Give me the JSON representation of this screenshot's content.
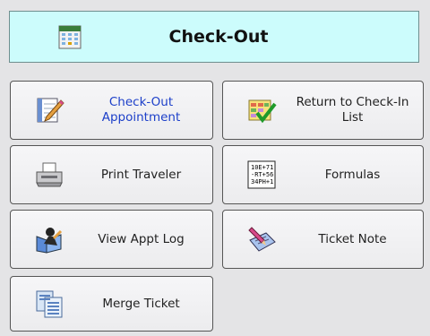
{
  "header": {
    "title": "Check-Out",
    "icon": "calendar-icon"
  },
  "buttons": {
    "checkout_appointment": {
      "label": "Check-Out\nAppointment",
      "icon": "appointment-edit-icon",
      "color": "#1c3fc9"
    },
    "return_checkin": {
      "label": "Return to Check-In\nList",
      "icon": "checklist-icon"
    },
    "print_traveler": {
      "label": "Print Traveler",
      "icon": "printer-icon"
    },
    "formulas": {
      "label": "Formulas",
      "icon": "formula-card-icon",
      "icon_text": [
        "10E+71",
        "-RT+56",
        "34PH+1"
      ]
    },
    "view_appt_log": {
      "label": "View Appt Log",
      "icon": "appointment-log-icon"
    },
    "ticket_note": {
      "label": "Ticket Note",
      "icon": "note-pencil-icon"
    },
    "merge_ticket": {
      "label": "Merge Ticket",
      "icon": "merge-documents-icon"
    }
  }
}
